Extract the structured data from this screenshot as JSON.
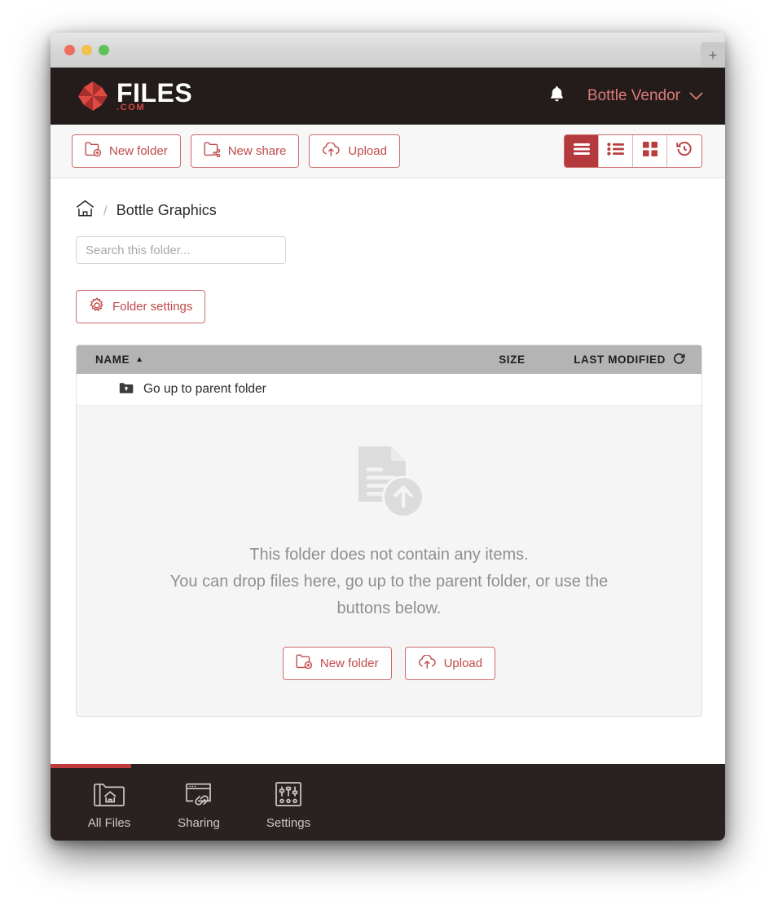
{
  "window": {
    "traffic_lights": [
      "close",
      "minimize",
      "maximize"
    ],
    "new_tab_label": "+"
  },
  "header": {
    "logo_text": "FILES",
    "logo_suffix": ".COM",
    "notifications_icon": "bell-icon",
    "account_name": "Bottle Vendor",
    "account_chevron": "∨"
  },
  "toolbar": {
    "new_folder_label": "New folder",
    "new_share_label": "New share",
    "upload_label": "Upload",
    "views": [
      {
        "name": "list-view",
        "icon": "hamburger-list-icon",
        "active": true
      },
      {
        "name": "detail-view",
        "icon": "bulleted-list-icon",
        "active": false
      },
      {
        "name": "grid-view",
        "icon": "grid-icon",
        "active": false
      },
      {
        "name": "history-view",
        "icon": "history-clock-icon",
        "active": false
      }
    ]
  },
  "breadcrumb": {
    "home_icon": "home-icon",
    "separator": "/",
    "current": "Bottle Graphics"
  },
  "search": {
    "placeholder": "Search this folder...",
    "value": ""
  },
  "folder_settings": {
    "label": "Folder settings",
    "icon": "gear-icon"
  },
  "table": {
    "columns": {
      "name": "NAME",
      "sort_indicator": "▲",
      "size": "SIZE",
      "last_modified": "LAST MODIFIED",
      "refresh_icon": "refresh-icon"
    },
    "parent_row": {
      "icon": "folder-up-icon",
      "label": "Go up to parent folder"
    },
    "rows": []
  },
  "empty_state": {
    "icon": "document-upload-icon",
    "line1": "This folder does not contain any items.",
    "line2": "You can drop files here, go up to the parent folder, or use the",
    "line3": "buttons below.",
    "new_folder_label": "New folder",
    "upload_label": "Upload"
  },
  "bottom_nav": {
    "progress_percent": 12,
    "items": [
      {
        "label": "All Files",
        "icon": "folder-home-icon",
        "active": true
      },
      {
        "label": "Sharing",
        "icon": "window-link-icon",
        "active": false
      },
      {
        "label": "Settings",
        "icon": "sliders-icon",
        "active": false
      }
    ]
  },
  "colors": {
    "brand_red": "#b43a3d",
    "outline_red": "#cf6b6b",
    "header_dark": "#231c1a",
    "nav_dark": "#2a2220",
    "table_header_gray": "#b4b4b4"
  }
}
